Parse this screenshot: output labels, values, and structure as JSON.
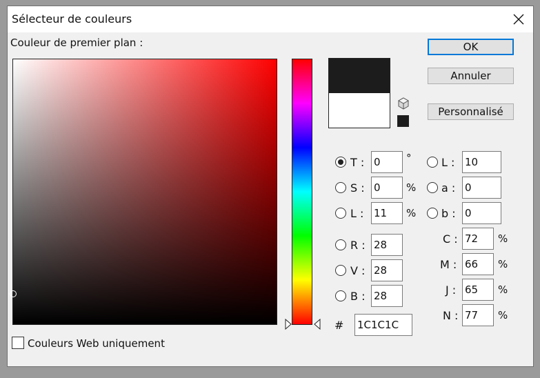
{
  "window": {
    "title": "Sélecteur de couleurs"
  },
  "heading": "Couleur de premier plan :",
  "buttons": {
    "ok": "OK",
    "cancel": "Annuler",
    "custom": "Personnalisé"
  },
  "colors": {
    "new": "#1c1c1c",
    "old": "#ffffff",
    "hue_top": "#ff0000",
    "accent": "#0078d7"
  },
  "hsb": {
    "h": {
      "label": "T :",
      "value": "0",
      "unit": "°"
    },
    "s": {
      "label": "S :",
      "value": "0",
      "unit": "%"
    },
    "b": {
      "label": "L :",
      "value": "11",
      "unit": "%"
    }
  },
  "lab": {
    "l": {
      "label": "L :",
      "value": "10"
    },
    "a": {
      "label": "a :",
      "value": "0"
    },
    "b": {
      "label": "b :",
      "value": "0"
    }
  },
  "rgb": {
    "r": {
      "label": "R :",
      "value": "28"
    },
    "g": {
      "label": "V :",
      "value": "28"
    },
    "b": {
      "label": "B :",
      "value": "28"
    }
  },
  "cmyk": {
    "c": {
      "label": "C :",
      "value": "72",
      "unit": "%"
    },
    "m": {
      "label": "M :",
      "value": "66",
      "unit": "%"
    },
    "y": {
      "label": "J :",
      "value": "65",
      "unit": "%"
    },
    "k": {
      "label": "N :",
      "value": "77",
      "unit": "%"
    }
  },
  "hex": {
    "label": "#",
    "value": "1C1C1C"
  },
  "web_only": {
    "label": "Couleurs Web uniquement",
    "checked": false
  }
}
